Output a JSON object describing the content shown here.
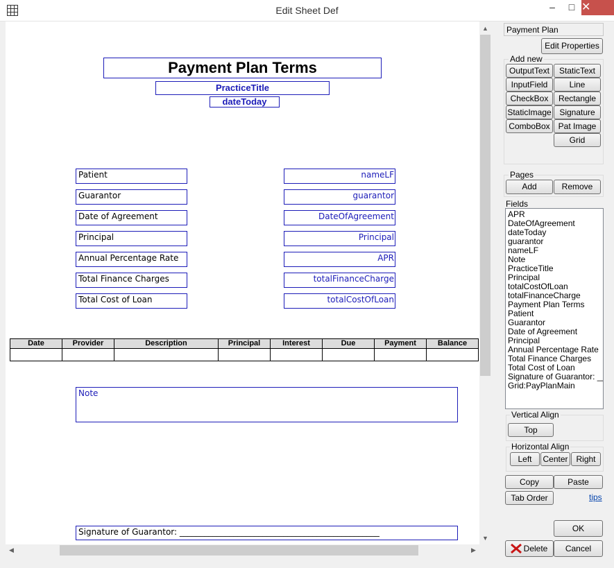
{
  "window": {
    "title": "Edit Sheet Def",
    "minimize": "–",
    "maximize": "□",
    "close": "✕"
  },
  "sheet": {
    "title": "Payment Plan Terms",
    "practice_title": "PracticeTitle",
    "date_today": "dateToday",
    "labels": [
      "Patient",
      "Guarantor",
      "Date of Agreement",
      "Principal",
      "Annual Percentage Rate",
      "Total Finance Charges",
      "Total Cost of Loan"
    ],
    "fields": [
      "nameLF",
      "guarantor",
      "DateOfAgreement",
      "Principal",
      "APR",
      "totalFinanceCharge",
      "totalCostOfLoan"
    ],
    "grid_columns": [
      "Date",
      "Provider",
      "Description",
      "Principal",
      "Interest",
      "Due",
      "Payment",
      "Balance"
    ],
    "note": "Note",
    "signature": "Signature of Guarantor: ________________________________________________"
  },
  "panel": {
    "sheet_name": "Payment Plan",
    "edit_properties": "Edit Properties",
    "add_new_title": "Add new",
    "add_new_buttons": [
      "OutputText",
      "StaticText",
      "InputField",
      "Line",
      "CheckBox",
      "Rectangle",
      "StaticImage",
      "Signature",
      "ComboBox",
      "Pat Image",
      "Grid"
    ],
    "pages_title": "Pages",
    "pages_add": "Add",
    "pages_remove": "Remove",
    "fields_title": "Fields",
    "fields_list": [
      "APR",
      "DateOfAgreement",
      "dateToday",
      "guarantor",
      "nameLF",
      "Note",
      "PracticeTitle",
      "Principal",
      "totalCostOfLoan",
      "totalFinanceCharge",
      "Payment Plan Terms",
      "Patient",
      "Guarantor",
      "Date of Agreement",
      "Principal",
      "Annual Percentage Rate",
      "Total Finance Charges",
      "Total Cost of Loan",
      "Signature of Guarantor: ____",
      "Grid:PayPlanMain"
    ],
    "valign_title": "Vertical Align",
    "valign_top": "Top",
    "halign_title": "Horizontal Align",
    "halign_left": "Left",
    "halign_center": "Center",
    "halign_right": "Right",
    "copy": "Copy",
    "paste": "Paste",
    "tab_order": "Tab Order",
    "tips": "tips",
    "ok": "OK",
    "delete": "Delete",
    "cancel": "Cancel"
  }
}
